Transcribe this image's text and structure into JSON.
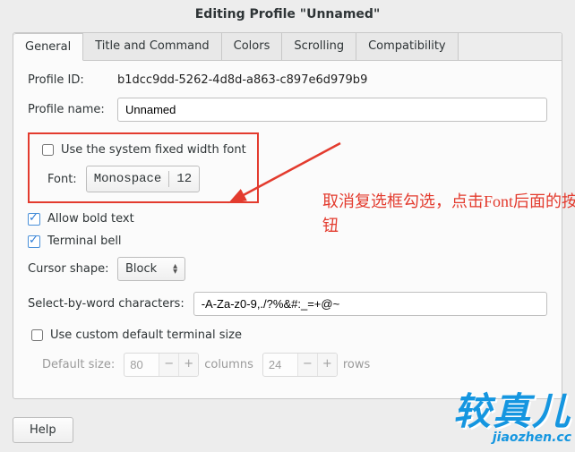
{
  "window": {
    "title": "Editing Profile \"Unnamed\""
  },
  "tabs": [
    {
      "label": "General"
    },
    {
      "label": "Title and Command"
    },
    {
      "label": "Colors"
    },
    {
      "label": "Scrolling"
    },
    {
      "label": "Compatibility"
    }
  ],
  "general": {
    "profile_id_label": "Profile ID:",
    "profile_id_value": "b1dcc9dd-5262-4d8d-a863-c897e6d979b9",
    "profile_name_label": "Profile name:",
    "profile_name_value": "Unnamed",
    "use_system_font_label": "Use the system fixed width font",
    "font_label": "Font:",
    "font_family": "Monospace",
    "font_size": "12",
    "allow_bold_label": "Allow bold text",
    "terminal_bell_label": "Terminal bell",
    "cursor_shape_label": "Cursor shape:",
    "cursor_shape_value": "Block",
    "select_by_word_label": "Select-by-word characters:",
    "select_by_word_value": "-A-Za-z0-9,./?%&#:_=+@~",
    "custom_size_label": "Use custom default terminal size",
    "default_size_label": "Default size:",
    "cols_value": "80",
    "cols_unit": "columns",
    "rows_value": "24",
    "rows_unit": "rows"
  },
  "buttons": {
    "help": "Help"
  },
  "annotation": {
    "text": "取消复选框勾选，点击Font后面的按钮"
  },
  "watermark": {
    "big": "较真儿",
    "small": "jiaozhen.cc"
  }
}
